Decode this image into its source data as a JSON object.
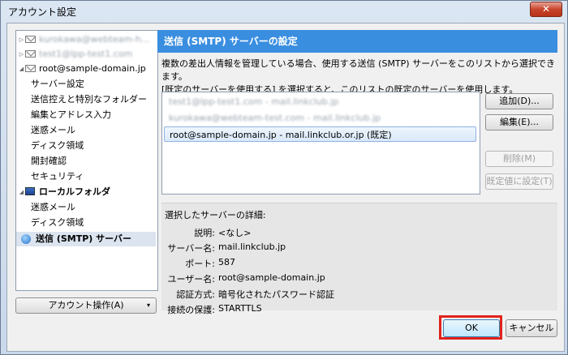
{
  "window": {
    "title": "アカウント設定",
    "close_symbol": "✕"
  },
  "tree": {
    "accounts": [
      {
        "label": "kurokawa@webteam-h...",
        "obscured": true
      },
      {
        "label": "test1@lpp-test1.com",
        "obscured": true
      },
      {
        "label": "root@sample-domain.jp",
        "obscured": false
      }
    ],
    "root_children": [
      "サーバー設定",
      "送信控えと特別なフォルダー",
      "編集とアドレス入力",
      "迷惑メール",
      "ディスク領域",
      "開封確認",
      "セキュリティ"
    ],
    "local_folder": {
      "label": "ローカルフォルダ",
      "children": [
        "迷惑メール",
        "ディスク領域"
      ]
    },
    "smtp_item": "送信 (SMTP) サーバー"
  },
  "account_actions_button": "アカウント操作(A)",
  "panel": {
    "heading": "送信 (SMTP) サーバーの設定",
    "desc_line1": "複数の差出人情報を管理している場合、使用する送信 (SMTP) サーバーをこのリストから選択できます。",
    "desc_line2": "[既定のサーバーを使用する] を選択すると、このリストの既定のサーバーを使用します。"
  },
  "server_list": [
    {
      "label": "test1@lpp-test1.com - mail.linkclub.jp",
      "obscured": true,
      "selected": false
    },
    {
      "label": "kurokawa@webteam-test.com - mail.linkclub.jp",
      "obscured": true,
      "selected": false
    },
    {
      "label": "root@sample-domain.jp - mail.linkclub.or.jp (既定)",
      "obscured": false,
      "selected": true
    }
  ],
  "buttons": {
    "add": "追加(D)...",
    "edit": "編集(E)...",
    "delete": "削除(M)",
    "set_default": "既定値に設定(T)",
    "ok": "OK",
    "cancel": "キャンセル"
  },
  "details": {
    "title": "選択したサーバーの詳細:",
    "rows": [
      {
        "label": "説明:",
        "value": "<なし>"
      },
      {
        "label": "サーバー名:",
        "value": "mail.linkclub.jp"
      },
      {
        "label": "ポート:",
        "value": "587"
      },
      {
        "label": "ユーザー名:",
        "value": "root@sample-domain.jp"
      },
      {
        "label": "認証方式:",
        "value": "暗号化されたパスワード認証"
      },
      {
        "label": "接続の保護:",
        "value": "STARTTLS"
      }
    ]
  },
  "colors": {
    "heading_bg": "#3a8ee0",
    "highlight": "#e0231c"
  }
}
